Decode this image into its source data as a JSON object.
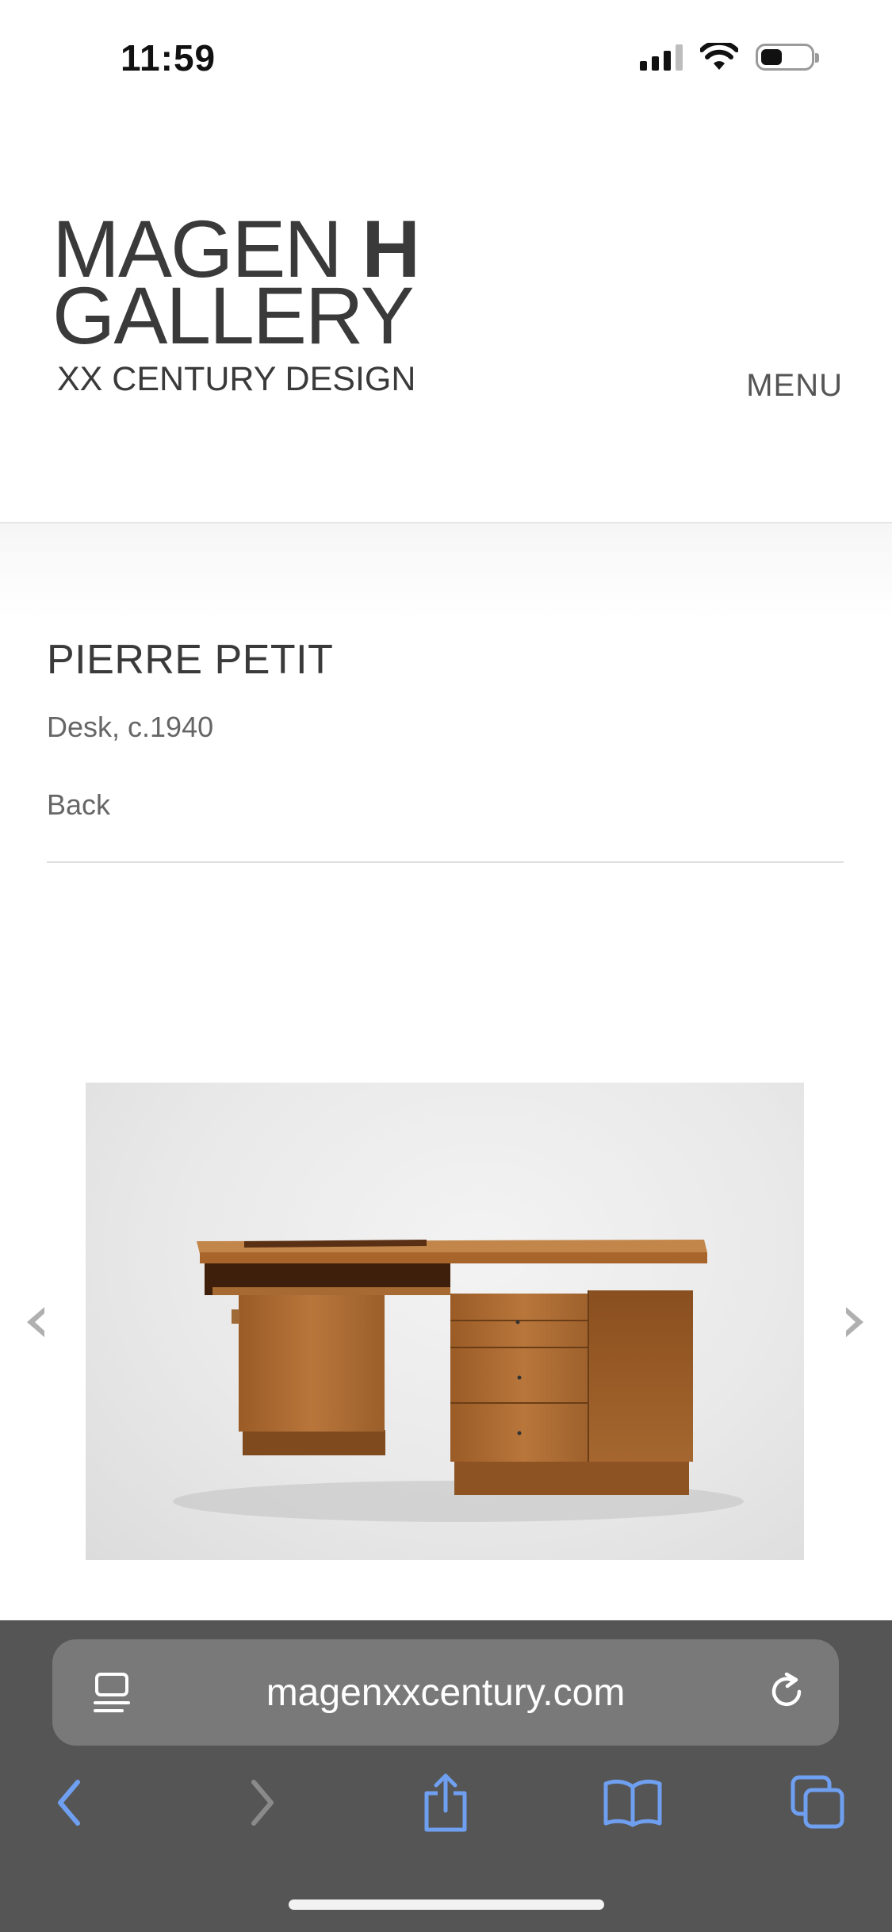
{
  "status": {
    "time": "11:59"
  },
  "header": {
    "logo": {
      "line1_light": "MAGEN ",
      "line1_bold": "H",
      "line2": "GALLERY",
      "line3": "XX CENTURY DESIGN"
    },
    "menu_label": "MENU"
  },
  "item": {
    "artist": "PIERRE PETIT",
    "title": "Desk, c.1940",
    "back_label": "Back"
  },
  "gallery": {
    "prev_icon": "chevron-left-icon",
    "next_icon": "chevron-right-icon"
  },
  "browser": {
    "url": "magenxxcentury.com",
    "icons": [
      "reader-icon",
      "reload-icon",
      "back-icon",
      "forward-icon",
      "share-icon",
      "bookmarks-icon",
      "tabs-icon"
    ],
    "accent_color": "#6f9ff0"
  }
}
